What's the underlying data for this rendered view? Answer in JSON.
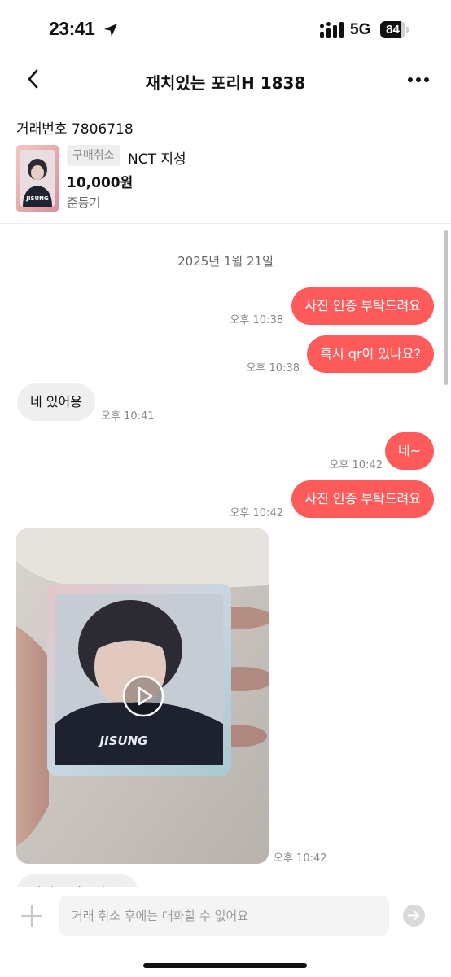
{
  "status_bar": {
    "time": "23:41",
    "location_icon": "location-arrow-icon",
    "signal_icon": "signal-bars-icon",
    "network": "5G",
    "battery_level": "84",
    "battery_fraction": 0.84
  },
  "header": {
    "back_icon": "chevron-left-icon",
    "title": "재치있는 포리H 1838",
    "more_icon": "more-horizontal-icon"
  },
  "trade": {
    "trade_number": "거래번호 7806718",
    "status_badge": "구매취소",
    "product_name": "NCT 지성",
    "price": "10,000원",
    "seller": "준등기"
  },
  "chat": {
    "date": "2025년 1월 21일",
    "messages": [
      {
        "side": "out",
        "text": "사진 인증 부탁드려요",
        "time": "오후 10:38"
      },
      {
        "side": "out",
        "text": "혹시 qr이 있나요?",
        "time": "오후 10:38"
      },
      {
        "side": "in",
        "text": "네 있어용",
        "time": "오후 10:41"
      },
      {
        "side": "out",
        "text": "네~",
        "time": "오후 10:42"
      },
      {
        "side": "out",
        "text": "사진 인증 부탁드려요",
        "time": "오후 10:42"
      },
      {
        "side": "in",
        "type": "video",
        "time": "오후 10:42",
        "icon": "play-icon"
      },
      {
        "side": "in",
        "text": "사진은 작시만녀",
        "partial": true
      }
    ]
  },
  "input": {
    "plus_icon": "plus-icon",
    "placeholder": "거래 취소 후에는 대화할 수 없어요",
    "send_icon": "send-arrow-icon"
  },
  "colors": {
    "accent": "#ff5b5b",
    "incoming_bubble": "#efefef",
    "timestamp": "#888888"
  }
}
